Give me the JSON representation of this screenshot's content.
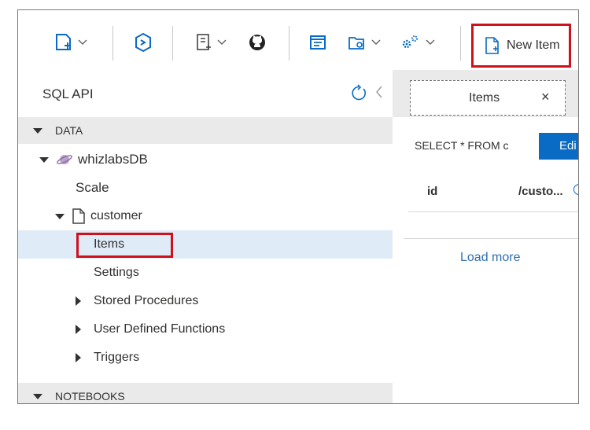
{
  "toolbar": {
    "new_item_label": "New Item",
    "highlight_color": "#d0101b"
  },
  "sidebar": {
    "title": "SQL API",
    "data_section": "DATA",
    "database": "whizlabsDB",
    "scale": "Scale",
    "collection": "customer",
    "items": "Items",
    "settings": "Settings",
    "stored_procedures": "Stored Procedures",
    "udfs": "User Defined Functions",
    "triggers": "Triggers",
    "notebooks_section": "NOTEBOOKS"
  },
  "tab": {
    "label": "Items",
    "close": "×"
  },
  "query": {
    "text": "SELECT * FROM c",
    "edit_label": "Edi"
  },
  "grid": {
    "columns": [
      "id",
      "/custo..."
    ]
  },
  "load_more": "Load more",
  "colors": {
    "selected_row": "#dfecf8",
    "section_band": "#eaeaea",
    "edit_button": "#0a6bc4"
  }
}
